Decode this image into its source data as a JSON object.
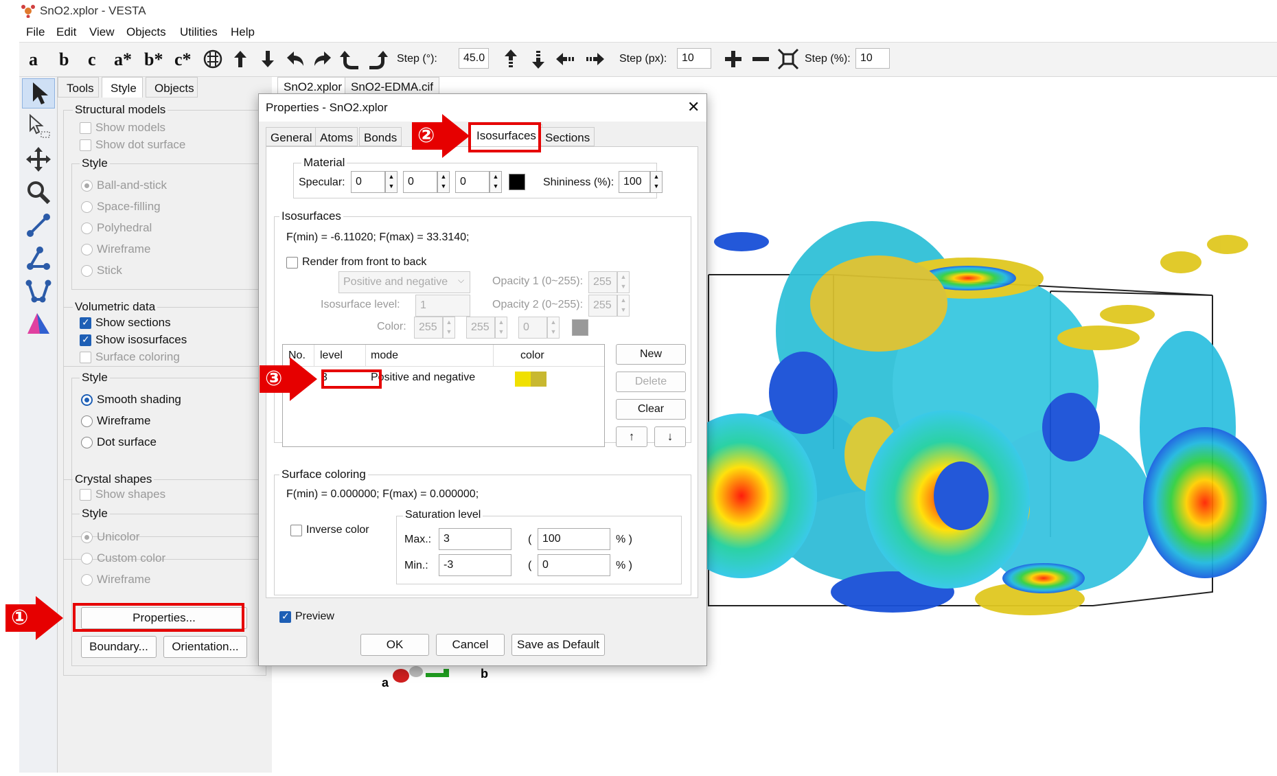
{
  "window": {
    "title": "SnO2.xplor - VESTA"
  },
  "menu": [
    "File",
    "Edit",
    "View",
    "Objects",
    "Utilities",
    "Help"
  ],
  "toolbar": {
    "axis_labels": [
      "a",
      "b",
      "c",
      "a*",
      "b*",
      "c*"
    ],
    "step_deg_label": "Step (°):",
    "step_deg_value": "45.0",
    "step_px_label": "Step (px):",
    "step_px_value": "10",
    "step_pct_label": "Step (%):",
    "step_pct_value": "10"
  },
  "left_panel": {
    "tabs": [
      "Tools",
      "Style",
      "Objects"
    ],
    "structural_models": {
      "title": "Structural models",
      "show_models": "Show models",
      "show_dot_surface": "Show dot surface",
      "style_title": "Style",
      "styles": [
        "Ball-and-stick",
        "Space-filling",
        "Polyhedral",
        "Wireframe",
        "Stick"
      ]
    },
    "volumetric": {
      "title": "Volumetric data",
      "show_sections": "Show sections",
      "show_isosurfaces": "Show isosurfaces",
      "surface_coloring": "Surface coloring",
      "style_title": "Style",
      "styles": [
        "Smooth shading",
        "Wireframe",
        "Dot surface"
      ]
    },
    "crystal": {
      "title": "Crystal shapes",
      "show_shapes": "Show shapes",
      "style_title": "Style",
      "styles": [
        "Unicolor",
        "Custom color",
        "Wireframe"
      ]
    },
    "properties_button": "Properties...",
    "boundary_button": "Boundary...",
    "orientation_button": "Orientation..."
  },
  "doc_tabs": [
    "SnO2.xplor",
    "SnO2-EDMA.cif"
  ],
  "dialog": {
    "title": "Properties - SnO2.xplor",
    "close": "✕",
    "tabs": [
      "General",
      "Atoms",
      "Bonds",
      "Isosurfaces",
      "Sections"
    ],
    "material": {
      "title": "Material",
      "specular_label": "Specular:",
      "specular": [
        "0",
        "0",
        "0"
      ],
      "shininess_label": "Shininess (%):",
      "shininess": "100"
    },
    "isosurfaces": {
      "title": "Isosurfaces",
      "fminmax": "F(min) = -6.11020;    F(max) = 33.3140;",
      "render_front_back": "Render from front to back",
      "mode_select": "Positive and negative",
      "opacity1_label": "Opacity 1 (0~255):",
      "opacity1": "255",
      "opacity2_label": "Opacity 2 (0~255):",
      "opacity2": "255",
      "level_label": "Isosurface level:",
      "level_value": "1",
      "color_label": "Color:",
      "color_values": [
        "255",
        "255",
        "0"
      ],
      "table_headers": [
        "No.",
        "level",
        "mode",
        "color"
      ],
      "row": {
        "level": "3",
        "mode": "Positive and negative"
      },
      "buttons": {
        "new": "New",
        "delete": "Delete",
        "clear": "Clear",
        "up": "↑",
        "down": "↓"
      }
    },
    "surface_coloring": {
      "title": "Surface coloring",
      "fminmax": "F(min) = 0.000000;    F(max) = 0.000000;",
      "inverse": "Inverse color",
      "saturation_title": "Saturation level",
      "max_label": "Max.:",
      "max": "3",
      "max_pct": "100",
      "min_label": "Min.:",
      "min": "-3",
      "min_pct": "0",
      "paren_open": "(",
      "pct_close": "% )"
    },
    "preview": "Preview",
    "ok": "OK",
    "cancel": "Cancel",
    "save_default": "Save as Default"
  },
  "callouts": [
    "①",
    "②",
    "③"
  ],
  "viewer": {
    "axis_a": "a",
    "axis_b": "b"
  },
  "colors": {
    "accent": "#1e5fb5",
    "callout_red": "#e60000"
  }
}
